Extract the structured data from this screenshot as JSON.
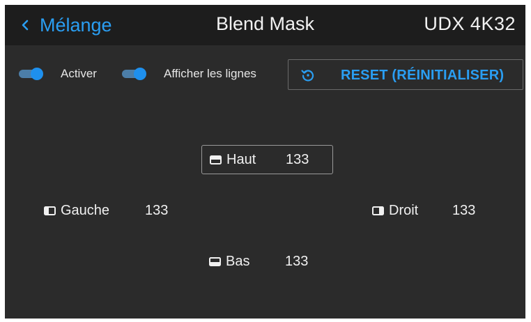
{
  "header": {
    "back_label": "Mélange",
    "title": "Blend Mask",
    "device": "UDX 4K32"
  },
  "controls": {
    "activate_label": "Activer",
    "activate_on": true,
    "show_lines_label": "Afficher les lignes",
    "show_lines_on": true,
    "reset_label": "RESET (RÉINITIALISER)"
  },
  "fields": {
    "top": {
      "label": "Haut",
      "value": "133",
      "icon": "blend-top-icon"
    },
    "left": {
      "label": "Gauche",
      "value": "133",
      "icon": "blend-left-icon"
    },
    "right": {
      "label": "Droit",
      "value": "133",
      "icon": "blend-right-icon"
    },
    "bottom": {
      "label": "Bas",
      "value": "133",
      "icon": "blend-bottom-icon"
    }
  },
  "colors": {
    "accent": "#2a9ef2",
    "header_bg": "#1d1d1d",
    "body_bg": "#2b2b2b"
  }
}
